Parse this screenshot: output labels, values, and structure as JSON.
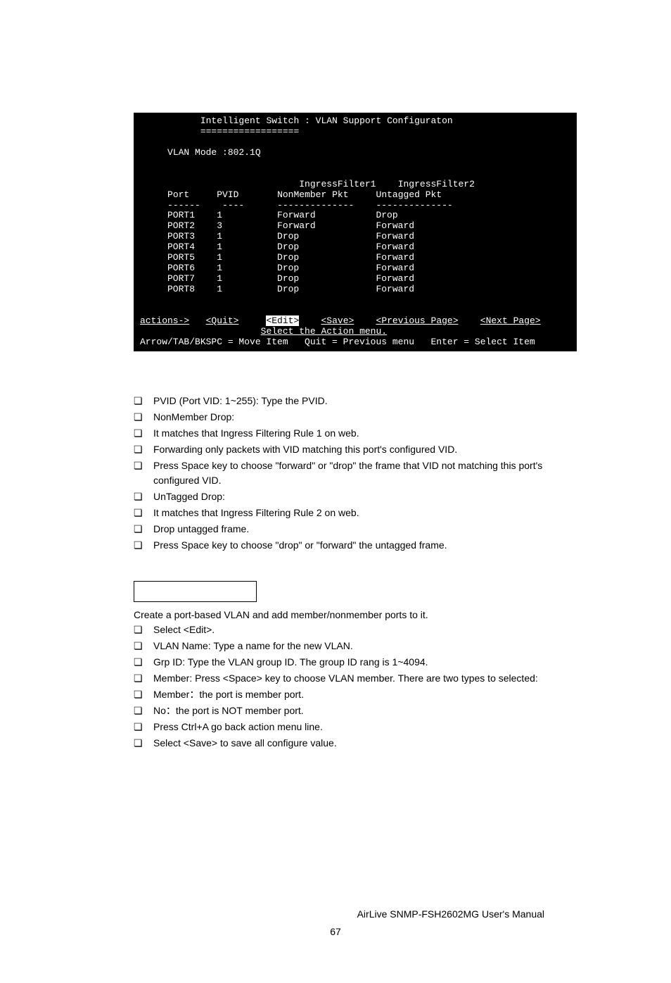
{
  "terminal": {
    "title": "Intelligent Switch : VLAN Support Configuraton",
    "underline": "==================",
    "vlan_mode": "VLAN Mode :802.1Q",
    "headers": {
      "port": "Port",
      "pvid": "PVID",
      "if1a": "IngressFilter1",
      "if1b": "NonMember Pkt",
      "if2a": "IngressFilter2",
      "if2b": "Untagged Pkt"
    },
    "dashes": "------    ----      --------------    --------------",
    "rows": [
      {
        "port": "PORT1",
        "pvid": "1",
        "f1": "Forward",
        "f2": "Drop"
      },
      {
        "port": "PORT2",
        "pvid": "3",
        "f1": "Forward",
        "f2": "Forward"
      },
      {
        "port": "PORT3",
        "pvid": "1",
        "f1": "Drop",
        "f2": "Forward"
      },
      {
        "port": "PORT4",
        "pvid": "1",
        "f1": "Drop",
        "f2": "Forward"
      },
      {
        "port": "PORT5",
        "pvid": "1",
        "f1": "Drop",
        "f2": "Forward"
      },
      {
        "port": "PORT6",
        "pvid": "1",
        "f1": "Drop",
        "f2": "Forward"
      },
      {
        "port": "PORT7",
        "pvid": "1",
        "f1": "Drop",
        "f2": "Forward"
      },
      {
        "port": "PORT8",
        "pvid": "1",
        "f1": "Drop",
        "f2": "Forward"
      }
    ],
    "actions_label": "actions->",
    "quit": "<Quit>",
    "edit": "<Edit>",
    "save": "<Save>",
    "prev": "<Previous Page>",
    "next": "<Next Page>",
    "select_action": "Select the Action menu.",
    "help_left": "Arrow/TAB/BKSPC = Move Item",
    "help_mid": "Quit = Previous menu",
    "help_right": "Enter = Select Item"
  },
  "list1": [
    "PVID (Port VID: 1~255): Type the PVID.",
    "NonMember Drop:",
    "It matches that Ingress Filtering Rule 1 on web.",
    "Forwarding only packets with VID matching this port's configured VID.",
    "Press Space key to choose \"forward\" or \"drop\" the frame that VID not matching this port's configured VID.",
    "UnTagged Drop:",
    "It matches that Ingress Filtering Rule 2 on web.",
    "Drop untagged frame.",
    "Press Space key to choose \"drop\" or \"forward\" the untagged frame."
  ],
  "para2": "Create a port-based VLAN and add member/nonmember ports to it.",
  "list2": [
    "Select <Edit>.",
    "VLAN Name: Type a name for the new VLAN.",
    "Grp ID: Type the VLAN group ID. The group ID rang is 1~4094.",
    "Member: Press <Space> key to choose VLAN member. There are two types to selected:",
    "Member：the port is member port.",
    "No：the port is NOT member port.",
    "Press Ctrl+A go back action menu line.",
    "Select <Save> to save all configure value."
  ],
  "footer_right": "AirLive SNMP-FSH2602MG User's Manual",
  "page_number": "67",
  "bullet_char": "❏"
}
